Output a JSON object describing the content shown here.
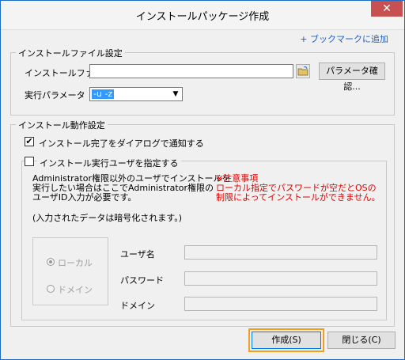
{
  "window": {
    "title": "インストールパッケージ作成",
    "close_glyph": "✕"
  },
  "bookmark_link": "+ ブックマークに追加",
  "install_file_group": {
    "legend": "インストールファイル設定",
    "file_label": "インストールファイル",
    "file_value": "",
    "browse_icon": "folder-browse-icon",
    "param_check_button": "パラメータ確認...",
    "param_label": "実行パラメータ",
    "param_value": "-u -z"
  },
  "install_action_group": {
    "legend": "インストール動作設定",
    "notify_checkbox_label": "インストール完了をダイアログで通知する",
    "notify_checked": "✔",
    "specify_user_checkbox_label": "インストール実行ユーザを指定する",
    "info_text": "Administrator権限以外のユーザでインストールを\n実行したい場合はここでAdministrator権限の\nユーザID入力が必要です。",
    "encrypted_note": "(入力されたデータは暗号化されます。)",
    "warning_text": "※注意事項\nローカル指定でパスワードが空だとOSの\n制限によってインストールができません。",
    "radio_local": "ローカル",
    "radio_domain": "ドメイン",
    "username_label": "ユーザ名",
    "password_label": "パスワード",
    "domain_label": "ドメイン"
  },
  "footer": {
    "create_button": "作成(S)",
    "close_button": "閉じる(C)"
  }
}
